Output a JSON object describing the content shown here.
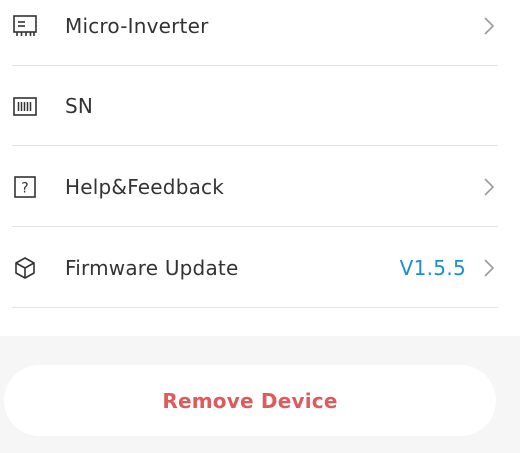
{
  "menu": {
    "items": [
      {
        "label": "Micro-Inverter",
        "icon": "micro-inverter-icon",
        "has_chevron": true
      },
      {
        "label": "SN",
        "icon": "barcode-icon",
        "has_chevron": false
      },
      {
        "label": "Help&Feedback",
        "icon": "help-icon",
        "has_chevron": true
      },
      {
        "label": "Firmware Update",
        "icon": "firmware-cube-icon",
        "value": "V1.5.5",
        "has_chevron": true
      }
    ]
  },
  "actions": {
    "remove_device_label": "Remove Device"
  },
  "colors": {
    "accent_value": "#1d8fcc",
    "danger": "#df5b5b",
    "text": "#333333",
    "chevron": "#9a9a9a"
  }
}
